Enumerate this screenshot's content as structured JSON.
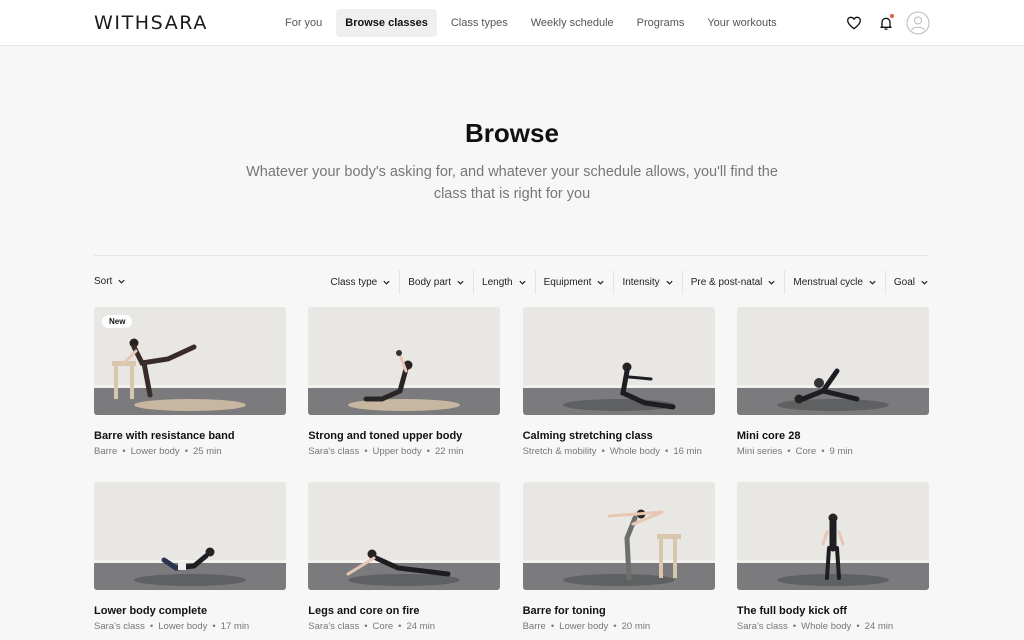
{
  "header": {
    "logo": "WITHSARA",
    "nav": [
      {
        "label": "For you",
        "active": false
      },
      {
        "label": "Browse classes",
        "active": true
      },
      {
        "label": "Class types",
        "active": false
      },
      {
        "label": "Weekly schedule",
        "active": false
      },
      {
        "label": "Programs",
        "active": false
      },
      {
        "label": "Your workouts",
        "active": false
      }
    ],
    "icons": [
      "heart-icon",
      "bell-icon",
      "avatar-icon"
    ],
    "notification_dot_color": "#e05a4a"
  },
  "hero": {
    "title": "Browse",
    "subtitle": "Whatever your body's asking for, and whatever your schedule allows, you'll find the class that is right for you"
  },
  "sort_label": "Sort",
  "filters": [
    "Class type",
    "Body part",
    "Length",
    "Equipment",
    "Intensity",
    "Pre & post-natal",
    "Menstrual cycle",
    "Goal"
  ],
  "cards": [
    {
      "title": "Barre with resistance band",
      "meta": [
        "Barre",
        "Lower body",
        "25 min"
      ],
      "badge": "New",
      "pose": "barre-chair"
    },
    {
      "title": "Strong and toned upper body",
      "meta": [
        "Sara's class",
        "Upper body",
        "22 min"
      ],
      "badge": "",
      "pose": "seated-v"
    },
    {
      "title": "Calming stretching class",
      "meta": [
        "Stretch & mobility",
        "Whole body",
        "16 min"
      ],
      "badge": "",
      "pose": "seated-stretch"
    },
    {
      "title": "Mini core 28",
      "meta": [
        "Mini series",
        "Core",
        "9 min"
      ],
      "badge": "",
      "pose": "ball-core"
    },
    {
      "title": "Lower body complete",
      "meta": [
        "Sara's class",
        "Lower body",
        "17 min"
      ],
      "badge": "",
      "pose": "side-lying"
    },
    {
      "title": "Legs and core on fire",
      "meta": [
        "Sara's class",
        "Core",
        "24 min"
      ],
      "badge": "",
      "pose": "side-plank"
    },
    {
      "title": "Barre for toning",
      "meta": [
        "Barre",
        "Lower body",
        "20 min"
      ],
      "badge": "",
      "pose": "standing-chair"
    },
    {
      "title": "The full body kick off",
      "meta": [
        "Sara's class",
        "Whole body",
        "24 min"
      ],
      "badge": "",
      "pose": "standing-band"
    }
  ]
}
